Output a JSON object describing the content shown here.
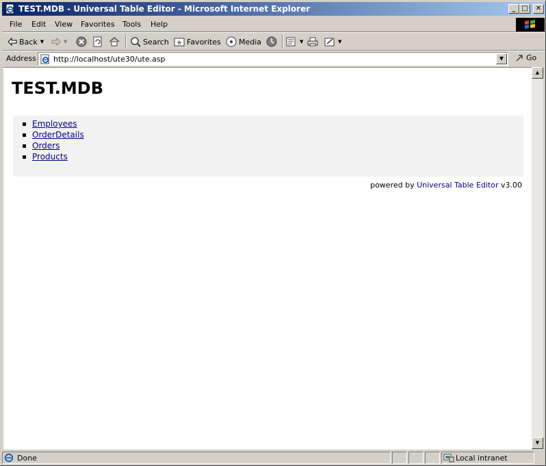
{
  "window": {
    "title": "TEST.MDB - Universal Table Editor - Microsoft Internet Explorer",
    "minimize_glyph": "_",
    "maximize_glyph": "□",
    "close_glyph": "✕"
  },
  "menu": [
    "File",
    "Edit",
    "View",
    "Favorites",
    "Tools",
    "Help"
  ],
  "toolbar": {
    "back_label": "Back",
    "search_label": "Search",
    "favorites_label": "Favorites",
    "media_label": "Media"
  },
  "address": {
    "label": "Address",
    "url": "http://localhost/ute30/ute.asp",
    "go_label": "Go"
  },
  "page": {
    "title": "TEST.MDB",
    "tables": [
      "Employees",
      "OrderDetails",
      "Orders",
      "Products"
    ],
    "powered_prefix": "powered by ",
    "powered_link": "Universal Table Editor",
    "powered_suffix": " v3.00"
  },
  "status": {
    "text": "Done",
    "zone": "Local intranet"
  },
  "colors": {
    "titlebar_start": "#0a246a",
    "titlebar_end": "#a6caf0",
    "link": "#000080",
    "list_panel_bg": "#f2f2f2",
    "chrome": "#d4d0c8"
  },
  "icons": {
    "app": "ie-page-icon",
    "windows_logo": "windows-flag-icon",
    "back": "back-arrow-icon",
    "forward": "forward-arrow-icon",
    "stop": "stop-icon",
    "refresh": "refresh-icon",
    "home": "home-icon",
    "search": "search-icon",
    "favorites": "favorites-icon",
    "media": "media-icon",
    "history": "history-icon",
    "mail": "mail-icon",
    "print": "print-icon",
    "edit": "edit-icon",
    "go": "go-arrow-icon",
    "intranet": "intranet-icon"
  }
}
